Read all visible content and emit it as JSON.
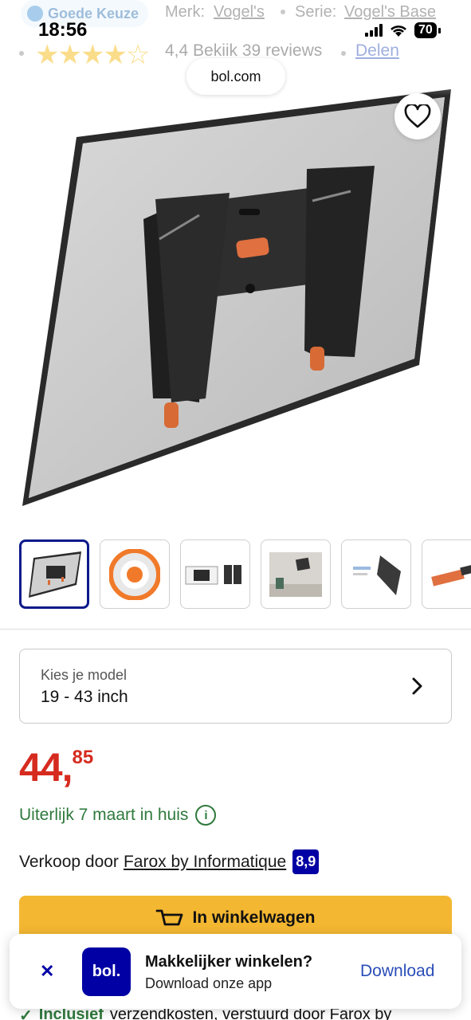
{
  "status_bar": {
    "time": "18:56",
    "battery": "70"
  },
  "meta": {
    "badge": "Goede Keuze",
    "brand_label": "Merk:",
    "brand_value": "Vogel's",
    "series_label": "Serie:",
    "series_value": "Vogel's Base",
    "rating": 4.4,
    "rating_text": "4,4 Bekiik 39 reviews",
    "share": "Delen"
  },
  "browser": {
    "url": "bol.com"
  },
  "thumbnails": [
    {
      "name": "wall-mount-front",
      "active": true
    },
    {
      "name": "life-time-guarantee"
    },
    {
      "name": "product-details"
    },
    {
      "name": "room-photo"
    },
    {
      "name": "tilt-side-view"
    },
    {
      "name": "mount-closeup"
    }
  ],
  "model": {
    "label": "Kies je model",
    "value": "19 - 43 inch"
  },
  "price": {
    "whole": "44,",
    "cents": "85"
  },
  "delivery": {
    "text": "Uiterlijk 7 maart in huis"
  },
  "seller": {
    "prefix": "Verkoop door",
    "name": "Farox by Informatique",
    "score": "8,9"
  },
  "cart": {
    "label": "In winkelwagen"
  },
  "shipping": {
    "bold": "Inclusief",
    "rest": "verzendkosten, verstuurd door Farox by"
  },
  "app_banner": {
    "logo": "bol.",
    "title": "Makkelijker winkelen?",
    "subtitle": "Download onze app",
    "download": "Download"
  },
  "colors": {
    "price": "#d62b1f",
    "brand_blue": "#0000a4",
    "cart_yellow": "#f4b731",
    "delivery_green": "#2f7a3d"
  }
}
